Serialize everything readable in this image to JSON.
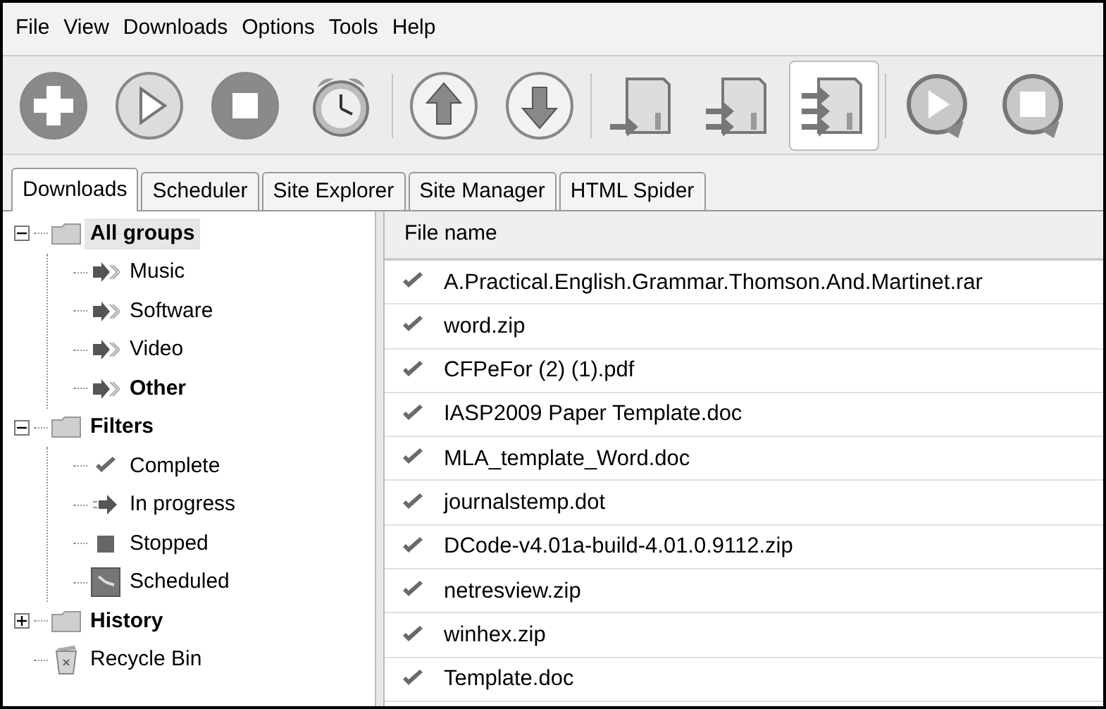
{
  "menu": [
    "File",
    "View",
    "Downloads",
    "Options",
    "Tools",
    "Help"
  ],
  "toolbar": [
    {
      "kind": "add",
      "pressed": false
    },
    {
      "kind": "play",
      "pressed": false
    },
    {
      "kind": "stop",
      "pressed": false
    },
    {
      "kind": "alarm",
      "pressed": false
    },
    {
      "kind": "separator"
    },
    {
      "kind": "up",
      "pressed": false
    },
    {
      "kind": "down",
      "pressed": false
    },
    {
      "kind": "separator"
    },
    {
      "kind": "doc-one",
      "pressed": false
    },
    {
      "kind": "doc-two",
      "pressed": false
    },
    {
      "kind": "doc-three",
      "pressed": true
    },
    {
      "kind": "separator"
    },
    {
      "kind": "cycle-play",
      "pressed": false
    },
    {
      "kind": "cycle-stop",
      "pressed": false
    }
  ],
  "tabs": [
    {
      "label": "Downloads",
      "selected": true
    },
    {
      "label": "Scheduler",
      "selected": false
    },
    {
      "label": "Site Explorer",
      "selected": false
    },
    {
      "label": "Site Manager",
      "selected": false
    },
    {
      "label": "HTML Spider",
      "selected": false
    }
  ],
  "tree": [
    {
      "label": "All groups",
      "kind": "folder",
      "bold": true,
      "selected": true,
      "expanded": true,
      "children": [
        {
          "label": "Music",
          "kind": "arrow",
          "bold": false,
          "selected": false
        },
        {
          "label": "Software",
          "kind": "arrow",
          "bold": false,
          "selected": false
        },
        {
          "label": "Video",
          "kind": "arrow",
          "bold": false,
          "selected": false
        },
        {
          "label": "Other",
          "kind": "arrow",
          "bold": true,
          "selected": false
        }
      ]
    },
    {
      "label": "Filters",
      "kind": "folder",
      "bold": true,
      "selected": false,
      "expanded": true,
      "children": [
        {
          "label": "Complete",
          "kind": "check",
          "bold": false,
          "selected": false
        },
        {
          "label": "In progress",
          "kind": "progress",
          "bold": false,
          "selected": false
        },
        {
          "label": "Stopped",
          "kind": "stopped",
          "bold": false,
          "selected": false
        },
        {
          "label": "Scheduled",
          "kind": "clock",
          "bold": false,
          "selected": false
        }
      ]
    },
    {
      "label": "History",
      "kind": "folder",
      "bold": true,
      "selected": false,
      "expanded": false
    },
    {
      "label": "Recycle Bin",
      "kind": "bin",
      "bold": false,
      "selected": false
    }
  ],
  "table": {
    "columns": [
      "File name"
    ],
    "rows": [
      {
        "name": "A.Practical.English.Grammar.Thomson.And.Martinet.rar"
      },
      {
        "name": "word.zip"
      },
      {
        "name": "CFPeFor (2) (1).pdf"
      },
      {
        "name": "IASP2009 Paper Template.doc"
      },
      {
        "name": "MLA_template_Word.doc"
      },
      {
        "name": "journalstemp.dot"
      },
      {
        "name": "DCode-v4.01a-build-4.01.0.9112.zip"
      },
      {
        "name": "netresview.zip"
      },
      {
        "name": "winhex.zip"
      },
      {
        "name": "Template.doc"
      }
    ]
  }
}
